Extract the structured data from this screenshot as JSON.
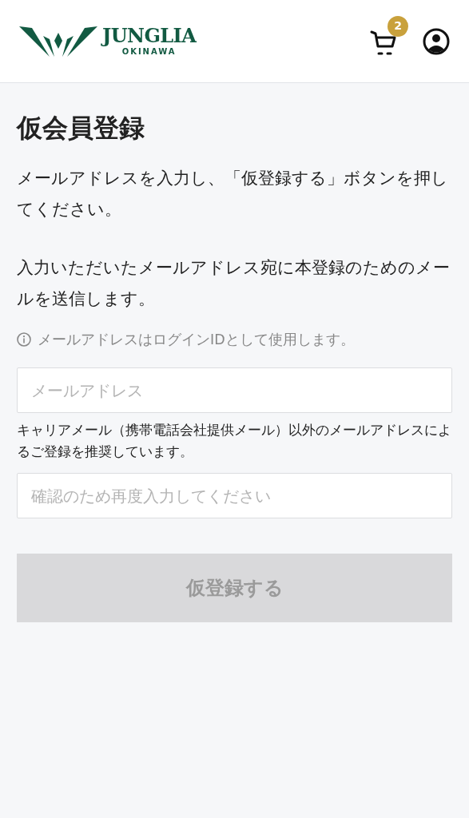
{
  "header": {
    "logo": {
      "name": "JUNGLIA",
      "sub": "OKINAWA"
    },
    "cart_count": "2"
  },
  "title": "仮会員登録",
  "paragraphs": [
    "メールアドレスを入力し、「仮登録する」ボタンを押してください。",
    "入力いただいたメールアドレス宛に本登録のためのメールを送信します。"
  ],
  "info": "メールアドレスはログインIDとして使用します。",
  "email": {
    "placeholder": "メールアドレス"
  },
  "email_note": "キャリアメール（携帯電話会社提供メール）以外のメールアドレスによるご登録を推奨しています。",
  "confirm": {
    "placeholder": "確認のため再度入力してください"
  },
  "submit": {
    "label": "仮登録する",
    "disabled": true
  }
}
